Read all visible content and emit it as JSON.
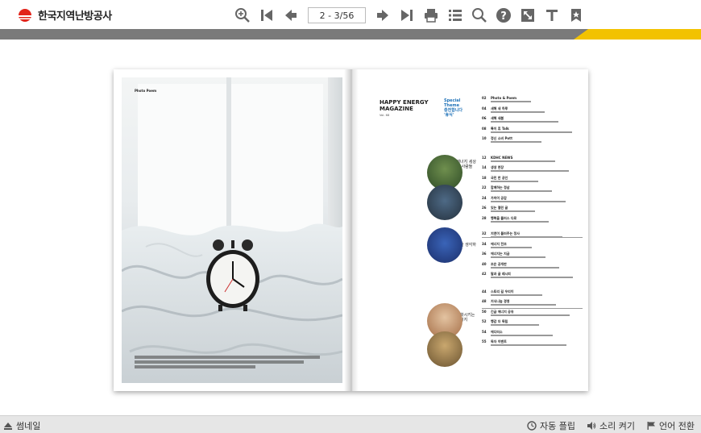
{
  "header": {
    "logo_text": "한국지역난방공사",
    "page_indicator": "2 - 3/56",
    "tools": [
      "zoom-in-icon",
      "first-page-icon",
      "prev-page-icon",
      "next-page-icon",
      "last-page-icon",
      "print-icon",
      "list-icon",
      "search-icon",
      "help-icon",
      "fullscreen-icon",
      "text-icon",
      "bookmark-icon"
    ]
  },
  "book": {
    "left_page": {
      "label": "Photo Poem"
    },
    "right_page": {
      "magazine_title_1": "HAPPY ENERGY",
      "magazine_title_2": "MAGAZINE",
      "issue": "Vol. 68",
      "special_theme_1": "Special",
      "special_theme_2": "Theme",
      "special_theme_3": "충전합니다",
      "special_theme_4": "'휴식'",
      "section_2": "행복을 에너지 세상을 만드는 사람들",
      "section_3": "지구 환경을 생각하는 에너지",
      "section_4": "세상을 변화시키는 행복한 에너지",
      "toc": [
        {
          "num": "02",
          "title": "Photo & Poem"
        },
        {
          "num": "04",
          "title": "새해 새 하루"
        },
        {
          "num": "06",
          "title": "새해 새봄"
        },
        {
          "num": "08",
          "title": "특이 휴 Talk"
        },
        {
          "num": "10",
          "title": "정신 소비 Pott"
        },
        {
          "num": "12",
          "title": "KDHC NEWS"
        },
        {
          "num": "14",
          "title": "생생 현장"
        },
        {
          "num": "18",
          "title": "국민 한 공인"
        },
        {
          "num": "22",
          "title": "함께하는 정삼"
        },
        {
          "num": "24",
          "title": "가까이 공감"
        },
        {
          "num": "26",
          "title": "있는 열린 글"
        },
        {
          "num": "28",
          "title": "행복을 플러스 다로"
        },
        {
          "num": "32",
          "title": "지엔이 불러주는 정사"
        },
        {
          "num": "34",
          "title": "에너지 전조"
        },
        {
          "num": "36",
          "title": "에너지는 지금"
        },
        {
          "num": "40",
          "title": "조은 공개판"
        },
        {
          "num": "42",
          "title": "말과 글 레시피"
        },
        {
          "num": "44",
          "title": "스토리 길 우리이"
        },
        {
          "num": "48",
          "title": "지식나눔 경영"
        },
        {
          "num": "50",
          "title": "긴급 에너지 공유"
        },
        {
          "num": "52",
          "title": "행감 더 독립"
        },
        {
          "num": "54",
          "title": "에디터소"
        },
        {
          "num": "55",
          "title": "독자 이벤트"
        }
      ]
    }
  },
  "footer": {
    "thumbnail_label": "썸네일",
    "autoflip_label": "자동 플립",
    "sound_label": "소리 켜기",
    "language_label": "언어 전환"
  },
  "colors": {
    "accent_yellow": "#f2c200",
    "stripe_gray": "#7a7a7a",
    "logo_red": "#e2231a",
    "theme_blue": "#1f72b8"
  }
}
